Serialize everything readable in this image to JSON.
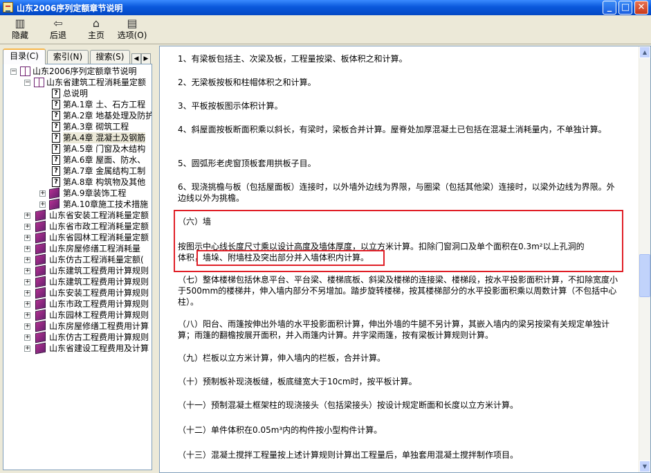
{
  "window": {
    "title": "山东2006序列定额章节说明"
  },
  "toolbar": {
    "hide": {
      "label": "隐藏",
      "icon": "hide-icon"
    },
    "back": {
      "label": "后退",
      "icon": "back-arrow-icon"
    },
    "home": {
      "label": "主页",
      "icon": "home-icon"
    },
    "options": {
      "label": "选项(O)",
      "icon": "options-icon"
    }
  },
  "tabs": {
    "contents": "目录(C)",
    "index": "索引(N)",
    "search": "搜索(S)"
  },
  "tree": {
    "root": "山东2006序列定额章节说明",
    "sub": "山东省建筑工程消耗量定额",
    "pages": [
      "总说明",
      "第A.1章 土、石方工程",
      "第A.2章 地基处理及防护",
      "第A.3章 砌筑工程",
      "第A.4章 混凝土及钢筋",
      "第A.5章 门窗及木结构",
      "第A.6章 屋面、防水、",
      "第A.7章 金属结构工制",
      "第A.8章 构筑物及其他"
    ],
    "subbooks": [
      "第A.9章装饰工程",
      "第A.10章施工技术措施"
    ],
    "books": [
      "山东省安装工程消耗量定额",
      "山东省市政工程消耗量定额",
      "山东省园林工程消耗量定额",
      "山东房屋修缮工程消耗量",
      "山东仿古工程消耗量定额(",
      "山东建筑工程费用计算规则",
      "山东建筑工程费用计算规则",
      "山东安装工程费用计算规则",
      "山东市政工程费用计算规则",
      "山东园林工程费用计算规则",
      "山东房屋修缮工程费用计算",
      "山东仿古工程费用计算规则",
      "山东省建设工程费用及计算"
    ]
  },
  "content": {
    "p1": "1、有梁板包括主、次梁及板，工程量按梁、板体积之和计算。",
    "p2": "2、无梁板按板和柱帽体积之和计算。",
    "p3": "3、平板按板图示体积计算。",
    "p4": "4、斜屋面按板断面积乘以斜长，有梁时，梁板合并计算。屋脊处加厚混凝土已包括在混凝土消耗量内，不单独计算。",
    "p5": "5、圆弧形老虎窗顶板套用拱板子目。",
    "p6": "6、现浇挑檐与板（包括屋面板）连接时，以外墙外边线为界限，与圈梁（包括其他梁）连接时，以梁外边线为界限。外边线以外为挑檐。",
    "h6": "（六）墙",
    "p7a": "按图示中心线长度尺寸乘以设计高度及墙体厚度，以立方米计算。扣除门窗洞口及单个面积在0.3m²以上孔洞的",
    "p7b_1": "体积，",
    "p7b_2": "墙垛、附墙柱及突出部分并入墙体积内计算。",
    "p8": "（七）整体楼梯包括休息平台、平台梁、楼梯底板、斜梁及楼梯的连接梁、楼梯段，按水平投影面积计算，不扣除宽度小于500mm的楼梯井，伸入墙内部分不另增加。踏步旋转楼梯，按其楼梯部分的水平投影面积乘以周数计算（不包括中心柱）。",
    "p9": "（八）阳台、雨篷按伸出外墙的水平投影面积计算，伸出外墙的牛腿不另计算，其嵌入墙内的梁另按梁有关规定单独计算；雨篷的翻檐按展开面积，并入雨篷内计算。井字梁雨篷，按有梁板计算规则计算。",
    "p10": "（九）栏板以立方米计算，伸入墙内的栏板，合并计算。",
    "p11": "（十）预制板补现浇板缝，板底缝宽大于10cm时，按平板计算。",
    "p12": "（十一）预制混凝土框架柱的现浇接头（包括梁接头）按设计规定断面和长度以立方米计算。",
    "p13": "（十二）单件体积在0.05m³内的构件按小型构件计算。",
    "p14": "（十三）混凝土搅拌工程量按上述计算规则计算出工程量后，单独套用混凝土搅拌制作项目。"
  },
  "colors": {
    "titlebar": "#0A58DC",
    "highlight_box": "#E01E26",
    "chrome": "#ECE9D8"
  }
}
